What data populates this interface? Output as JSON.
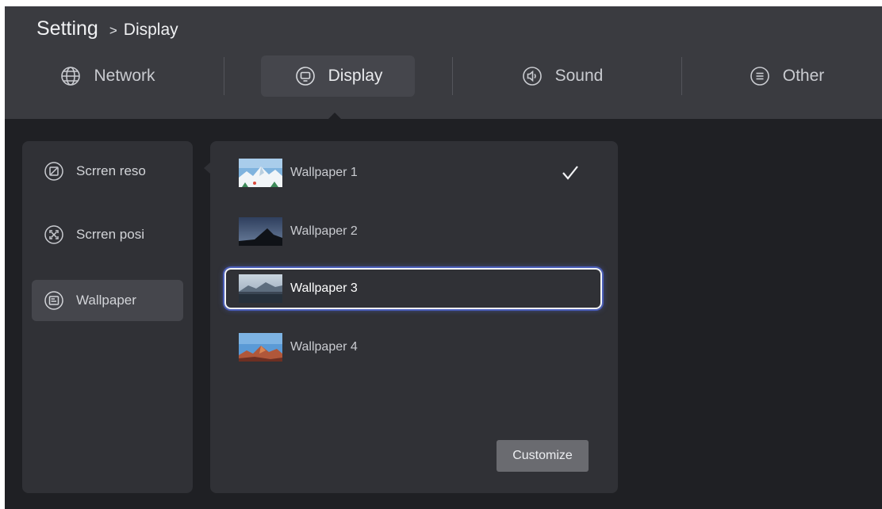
{
  "breadcrumb": {
    "root": "Setting",
    "separator": ">",
    "current": "Display"
  },
  "tabs": [
    {
      "label": "Network",
      "icon": "globe-icon",
      "active": false
    },
    {
      "label": "Display",
      "icon": "monitor-icon",
      "active": true
    },
    {
      "label": "Sound",
      "icon": "speaker-icon",
      "active": false
    },
    {
      "label": "Other",
      "icon": "menu-list-icon",
      "active": false
    }
  ],
  "display_menu": {
    "items": [
      {
        "label": "Scrren reso",
        "icon": "resolution-icon",
        "selected": false
      },
      {
        "label": "Scrren posi",
        "icon": "screen-position-icon",
        "selected": false
      },
      {
        "label": "Wallpaper",
        "icon": "wallpaper-icon",
        "selected": true
      }
    ]
  },
  "wallpapers": {
    "items": [
      {
        "label": "Wallpaper 1",
        "thumbnail": "snowy-mountain-thumbnail",
        "checked": true,
        "focused": false
      },
      {
        "label": "Wallpaper 2",
        "thumbnail": "dusk-peak-thumbnail",
        "checked": false,
        "focused": false
      },
      {
        "label": "Wallpaper 3",
        "thumbnail": "misty-lake-thumbnail",
        "checked": false,
        "focused": true
      },
      {
        "label": "Wallpaper 4",
        "thumbnail": "red-rock-thumbnail",
        "checked": false,
        "focused": false
      }
    ],
    "customize_label": "Customize"
  },
  "colors": {
    "background": "#1f2024",
    "header": "#3a3b40",
    "panel": "#303136",
    "selected": "#45464c",
    "focus_glow": "#5a76ff",
    "button": "#6a6b70"
  }
}
